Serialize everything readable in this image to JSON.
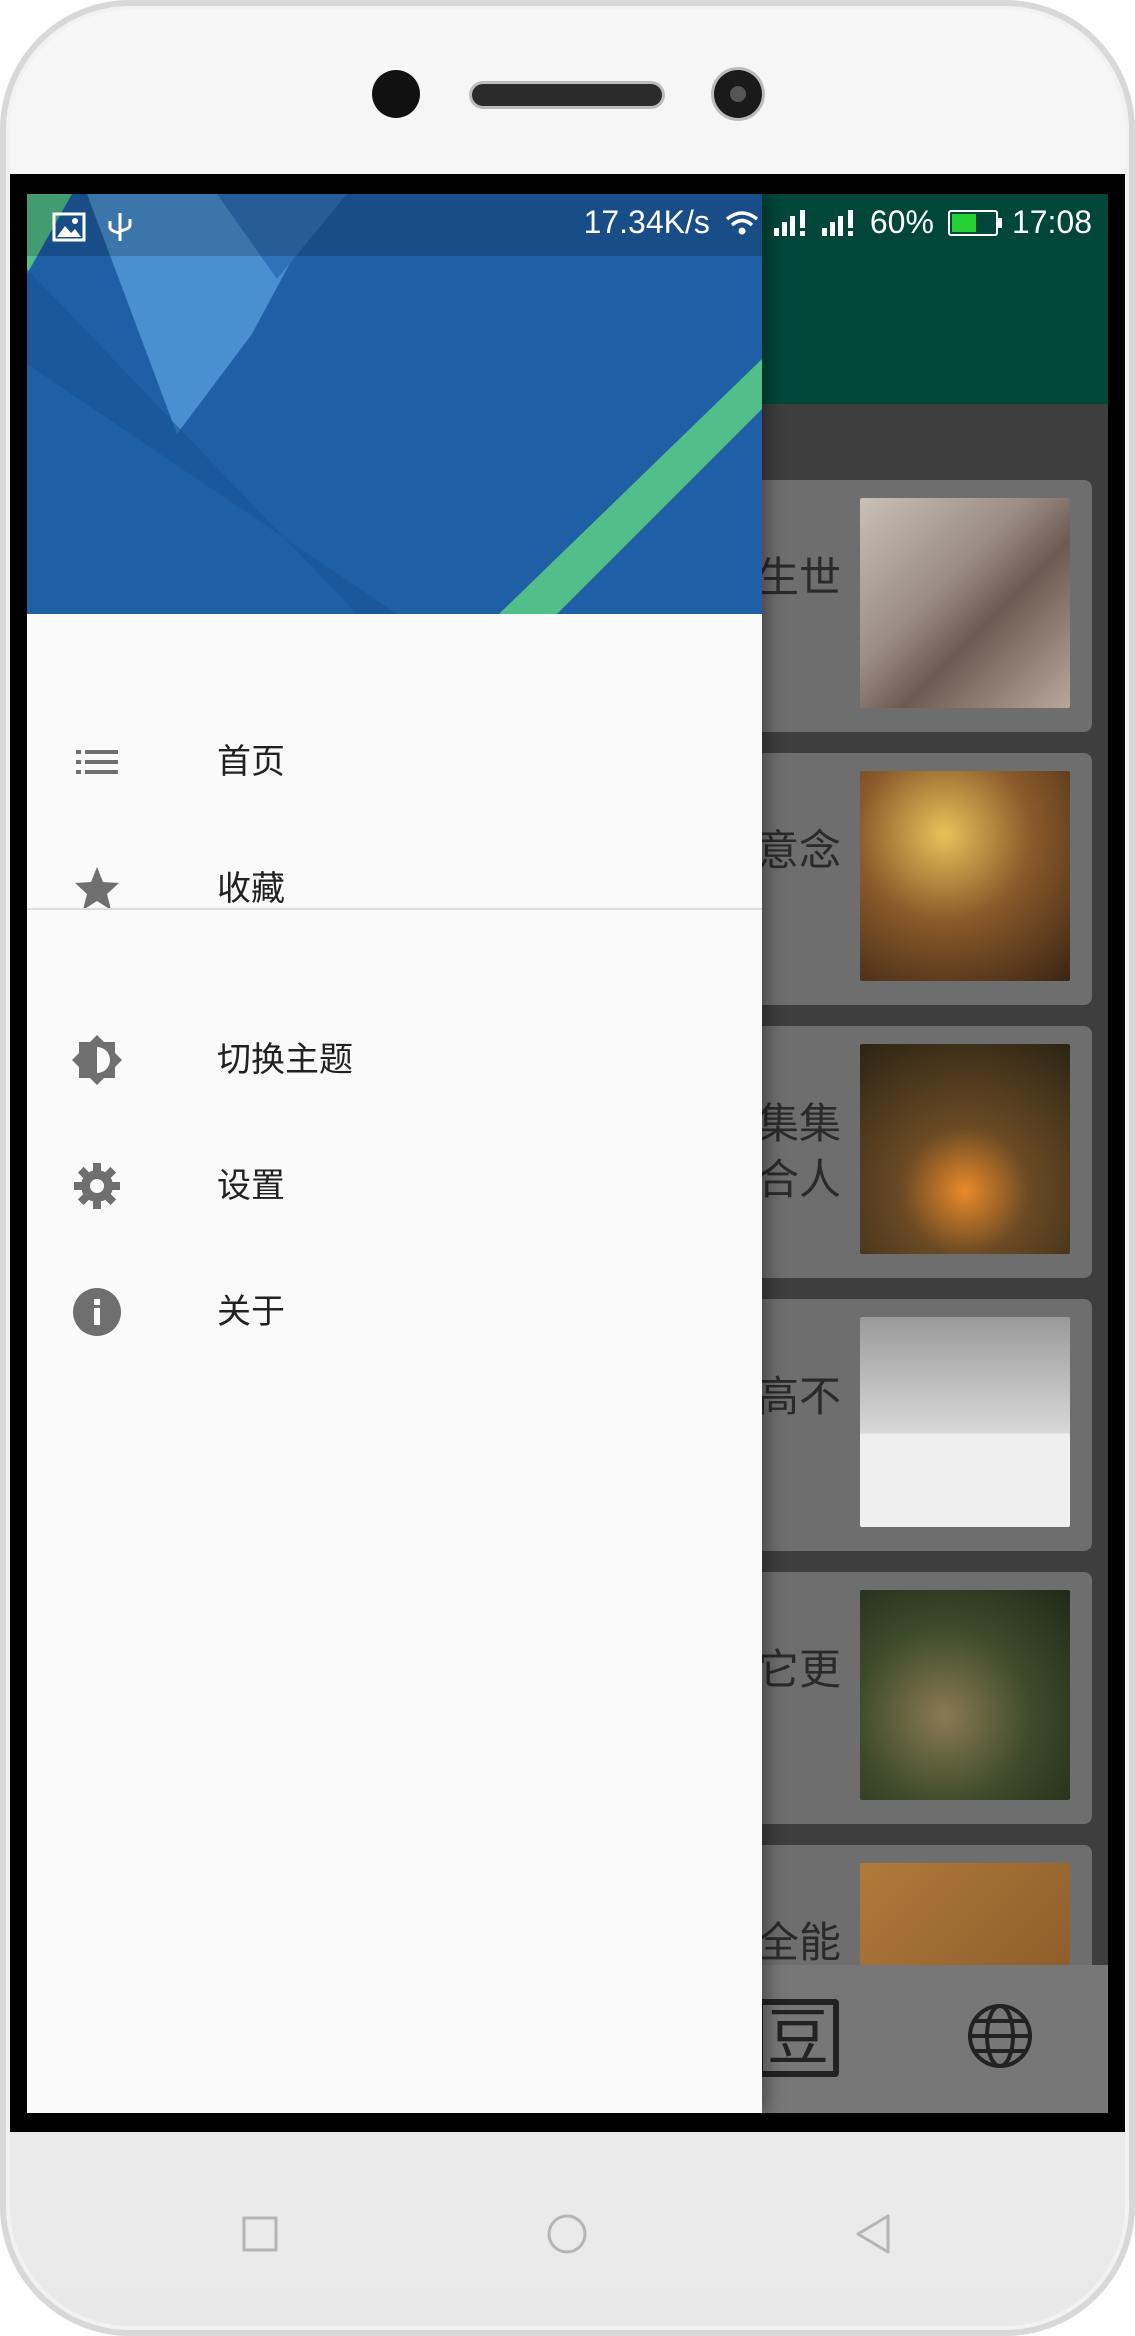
{
  "status_bar": {
    "net_speed": "17.34K/s",
    "battery_percent": "60%",
    "battery_level": 0.6,
    "time": "17:08",
    "battery_color": "#25d135"
  },
  "drawer": {
    "header_colors": {
      "base": "#1e5fa6",
      "light": "#4a8fd0",
      "accent": "#52be89"
    },
    "primary_items": [
      {
        "label": "首页",
        "icon": "list-icon"
      },
      {
        "label": "收藏",
        "icon": "star-icon"
      }
    ],
    "secondary_items": [
      {
        "label": "切换主题",
        "icon": "brightness-icon"
      },
      {
        "label": "设置",
        "icon": "gear-icon"
      },
      {
        "label": "关于",
        "icon": "info-icon"
      }
    ]
  },
  "background_list": {
    "cards": [
      {
        "text": "生世"
      },
      {
        "text": "意念"
      },
      {
        "text": "集集\n合人"
      },
      {
        "text": "高不"
      },
      {
        "text": "它更"
      },
      {
        "text": "全能"
      }
    ],
    "bottom_bar": {
      "left_icon": "dou-icon",
      "left_glyph": "豆",
      "right_icon": "globe-icon"
    }
  },
  "nav_bar": {
    "buttons": [
      "recents-button",
      "home-button",
      "back-button"
    ]
  }
}
